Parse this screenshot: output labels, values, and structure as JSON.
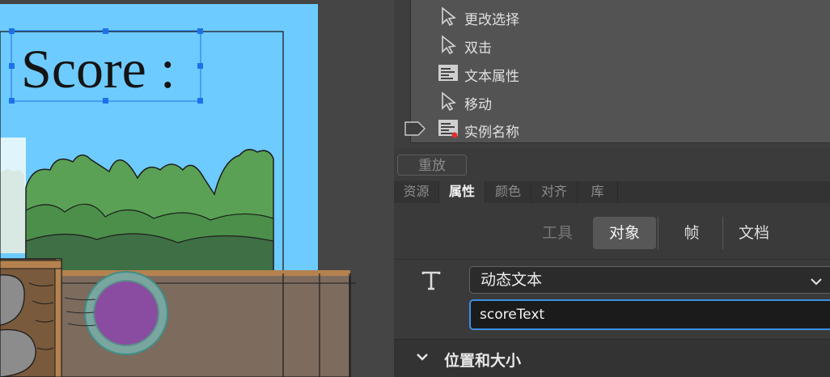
{
  "stage": {
    "score_label": "Score :"
  },
  "history": {
    "items": [
      {
        "label": "更改选择",
        "icon": "cursor-arrow-icon"
      },
      {
        "label": "双击",
        "icon": "cursor-arrow-icon"
      },
      {
        "label": "文本属性",
        "icon": "text-properties-icon"
      },
      {
        "label": "移动",
        "icon": "cursor-arrow-icon"
      },
      {
        "label": "实例名称",
        "icon": "text-properties-icon"
      }
    ],
    "replay_label": "重放"
  },
  "tabs": [
    {
      "label": "资源",
      "active": false
    },
    {
      "label": "属性",
      "active": true
    },
    {
      "label": "颜色",
      "active": false
    },
    {
      "label": "对齐",
      "active": false
    },
    {
      "label": "库",
      "active": false
    }
  ],
  "segments": {
    "tool": "工具",
    "object": "对象",
    "frame": "帧",
    "document": "文档",
    "active": "object"
  },
  "object": {
    "text_type": "动态文本",
    "instance_name": "scoreText"
  },
  "section": {
    "position_size": "位置和大小"
  },
  "colors": {
    "sky": "#6ecbff",
    "accent_blue": "#3d8fe0",
    "tree_green": "#5aa155",
    "ground": "#7d6b5e",
    "ball": "#8a4ca0"
  }
}
